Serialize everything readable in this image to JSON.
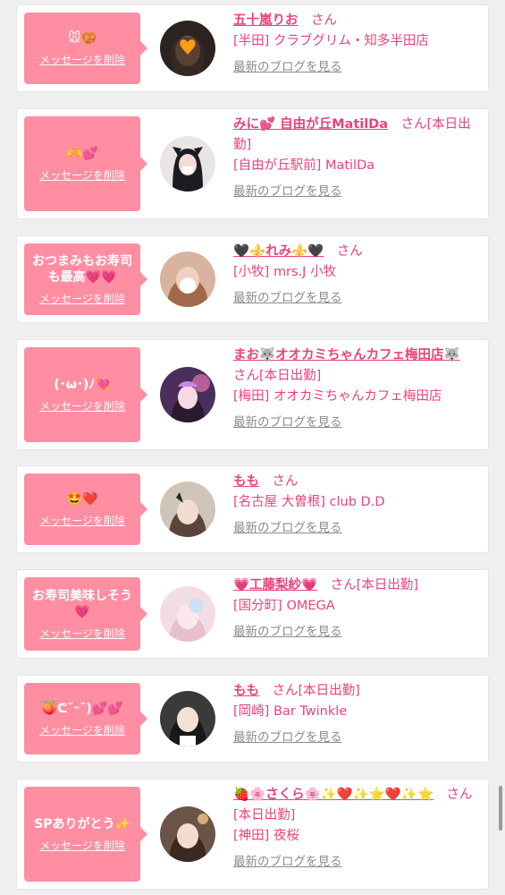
{
  "delete_label": "メッセージを削除",
  "blog_label": "最新のブログを見る",
  "san_label": "さん",
  "cards": [
    {
      "message": "🐭🥨",
      "name": "五十嵐りお",
      "status": "",
      "shop_area": "[半田]",
      "shop_name": "クラブグリム・知多半田店"
    },
    {
      "message": "🫶💕",
      "name": "みに💕 自由が丘MatilDa",
      "status": "[本日出勤]",
      "shop_area": "[自由が丘駅前]",
      "shop_name": "MatilDa"
    },
    {
      "message": "おつまみもお寿司も最高💗💗",
      "name": "🖤⚜️れみ⚜️🖤",
      "status": "",
      "shop_area": "[小牧]",
      "shop_name": "mrs.J 小牧"
    },
    {
      "message": "(･ω･)ﾉ💘",
      "name": "まお🐺オオカミちゃんカフェ梅田店🐺",
      "status": "[本日出勤]",
      "shop_area": "[梅田]",
      "shop_name": "オオカミちゃんカフェ梅田店"
    },
    {
      "message": "🤩❤️",
      "name": "もも",
      "status": "",
      "shop_area": "[名古屋 大曽根]",
      "shop_name": "club D.D"
    },
    {
      "message": "お寿司美味しそう💗",
      "name": "💗工藤梨紗💗",
      "status": "[本日出勤]",
      "shop_area": "[国分町]",
      "shop_name": "OMEGA"
    },
    {
      "message": "🍑ᕦ˘ᵕ˘)💕💕",
      "name": "もも",
      "status": "[本日出勤]",
      "shop_area": "[岡崎]",
      "shop_name": "Bar Twinkle"
    },
    {
      "message": "SPありがとう✨",
      "name": "🍓🌸さくら🌸✨❤️✨⭐❤️✨⭐",
      "status": "[本日出勤]",
      "shop_area": "[神田]",
      "shop_name": "夜桜"
    }
  ],
  "colors": {
    "bubble": "#ff8ea3",
    "accent": "#e8447a",
    "muted": "#8c8c8c",
    "background": "#efefef"
  }
}
